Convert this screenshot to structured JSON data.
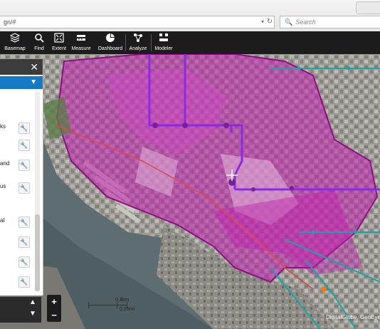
{
  "browser": {
    "url": "gn/#",
    "search_placeholder": "Search"
  },
  "toolbar": {
    "tools": [
      {
        "label": "Basemap",
        "icon": "basemap-layers-icon"
      },
      {
        "label": "Find",
        "icon": "magnifier-icon"
      },
      {
        "label": "Extent",
        "icon": "extent-icon"
      },
      {
        "label": "Measure",
        "icon": "measure-icon"
      },
      {
        "label": "Dashboard",
        "icon": "pie-chart-icon"
      },
      {
        "label": "Analyze",
        "icon": "network-icon"
      },
      {
        "label": "Modeler",
        "icon": "grid-icon"
      }
    ]
  },
  "panel": {
    "close_glyph": "✕",
    "items": [
      {
        "text": "ks"
      },
      {
        "text": ""
      },
      {
        "text": "and"
      },
      {
        "text": "us"
      },
      {
        "text": "al"
      },
      {
        "text": ""
      },
      {
        "text": ""
      },
      {
        "text": ""
      }
    ]
  },
  "map": {
    "scale_km": "0.4km",
    "scale_mi": "0.25mi",
    "attribution": "DigitalGlobe, GeoEye",
    "overlay_color": "#c21fb0",
    "route_color": "#8a2be2",
    "transit_color": "#1aa3a8"
  }
}
